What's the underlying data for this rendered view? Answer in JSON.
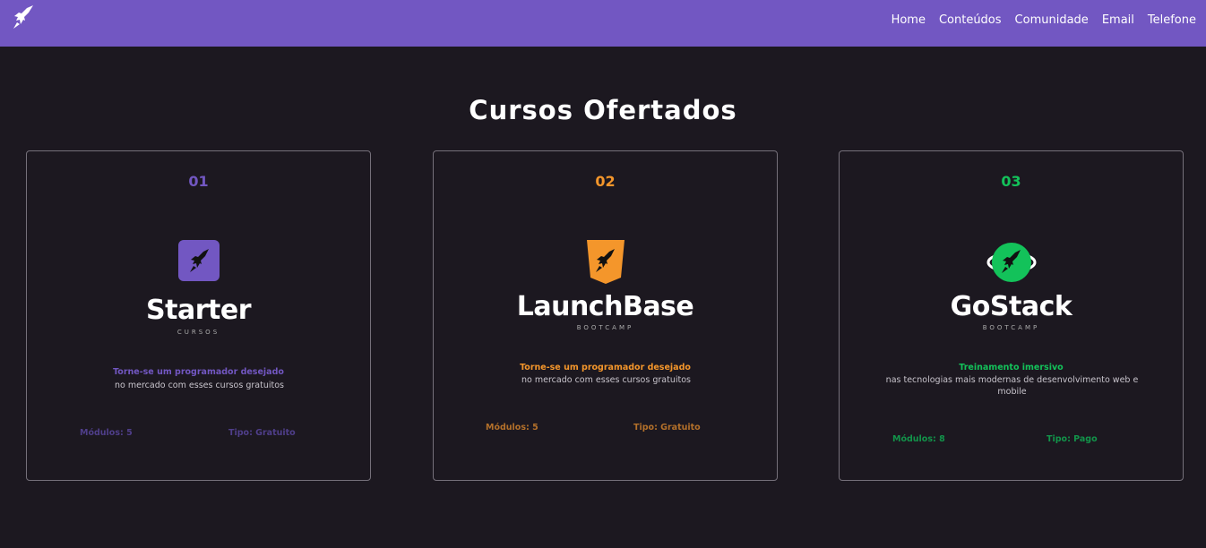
{
  "nav": {
    "items": [
      "Home",
      "Conteúdos",
      "Comunidade",
      "Email",
      "Telefone"
    ]
  },
  "page": {
    "title": "Cursos Ofertados"
  },
  "cards": [
    {
      "number": "01",
      "name": "Starter",
      "subtitle": "CURSOS",
      "highlight": "Torne-se um programador desejado",
      "description": "no mercado com esses cursos gratuitos",
      "modules": "Módulos: 5",
      "type": "Tipo: Gratuito",
      "accent": "#7257c2",
      "meta_color": "#4f3e8a"
    },
    {
      "number": "02",
      "name": "LaunchBase",
      "subtitle": "BOOTCAMP",
      "highlight": "Torne-se um programador desejado",
      "description": "no mercado com esses cursos gratuitos",
      "modules": "Módulos: 5",
      "type": "Tipo: Gratuito",
      "accent": "#f4962b",
      "meta_color": "#b3702a"
    },
    {
      "number": "03",
      "name": "GoStack",
      "subtitle": "BOOTCAMP",
      "highlight": "Treinamento imersivo",
      "description": "nas tecnologias mais modernas de desenvolvimento web e mobile",
      "modules": "Módulos: 8",
      "type": "Tipo: Pago",
      "accent": "#13c25a",
      "meta_color": "#12944a"
    }
  ]
}
